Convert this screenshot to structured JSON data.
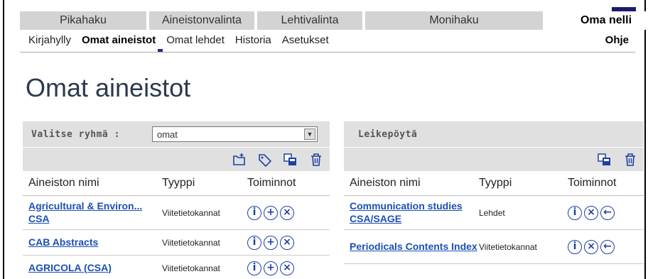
{
  "nav": {
    "tabs": [
      {
        "label": "Pikahaku"
      },
      {
        "label": "Aineistonvalinta"
      },
      {
        "label": "Lehtivalinta"
      },
      {
        "label": "Monihaku"
      },
      {
        "label": "Oma nelli"
      }
    ],
    "subnav": [
      {
        "label": "Kirjahylly"
      },
      {
        "label": "Omat aineistot"
      },
      {
        "label": "Omat lehdet"
      },
      {
        "label": "Historia"
      },
      {
        "label": "Asetukset"
      }
    ],
    "help_label": "Ohje"
  },
  "page": {
    "title": "Omat aineistot"
  },
  "left_panel": {
    "group_label": "Valitse ryhmä :",
    "group_value": "omat",
    "toolbar_icons": [
      "new-folder-icon",
      "tag-icon",
      "copy-icon",
      "trash-icon"
    ],
    "headers": {
      "name": "Aineiston nimi",
      "type": "Tyyppi",
      "actions": "Toiminnot"
    },
    "rows": [
      {
        "name": "Agricultural & Environ... CSA",
        "type": "Viitetietokannat",
        "actions": [
          "info",
          "add",
          "remove"
        ]
      },
      {
        "name": "CAB Abstracts",
        "type": "Viitetietokannat",
        "actions": [
          "info",
          "add",
          "remove"
        ]
      },
      {
        "name": "AGRICOLA (CSA)",
        "type": "Viitetietokannat",
        "actions": [
          "info",
          "add",
          "remove"
        ]
      }
    ]
  },
  "right_panel": {
    "title": "Leikepöytä",
    "toolbar_icons": [
      "copy-icon",
      "trash-icon"
    ],
    "headers": {
      "name": "Aineiston nimi",
      "type": "Tyyppi",
      "actions": "Toiminnot"
    },
    "rows": [
      {
        "name": "Communication studies CSA/SAGE",
        "type": "Lehdet",
        "actions": [
          "info",
          "remove",
          "back"
        ]
      },
      {
        "name": "Periodicals Contents Index",
        "type": "Viitetietokannat",
        "actions": [
          "info",
          "remove",
          "back"
        ]
      }
    ]
  },
  "colors": {
    "link": "#1c4fb5",
    "tab_bg": "#d3d3d3",
    "panel_bg": "#e0e0e0",
    "title": "#2b3a4f"
  }
}
